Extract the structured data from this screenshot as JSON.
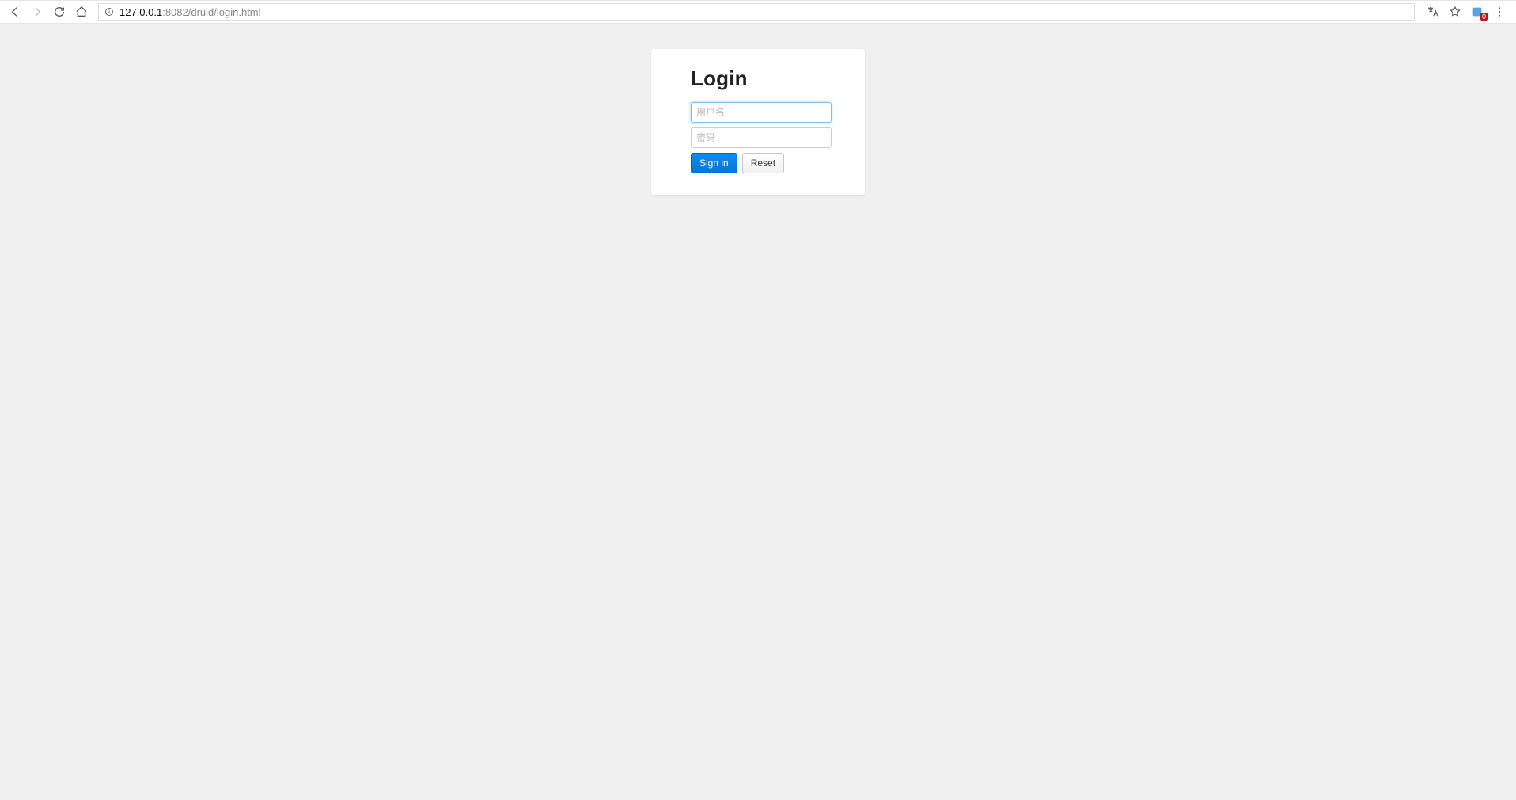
{
  "browser": {
    "url": {
      "host": "127.0.0.1",
      "port_path": ":8082/druid/login.html"
    },
    "extension_badge": "0"
  },
  "login": {
    "heading": "Login",
    "username_placeholder": "用户名",
    "password_placeholder": "密码",
    "signin_label": "Sign in",
    "reset_label": "Reset"
  }
}
